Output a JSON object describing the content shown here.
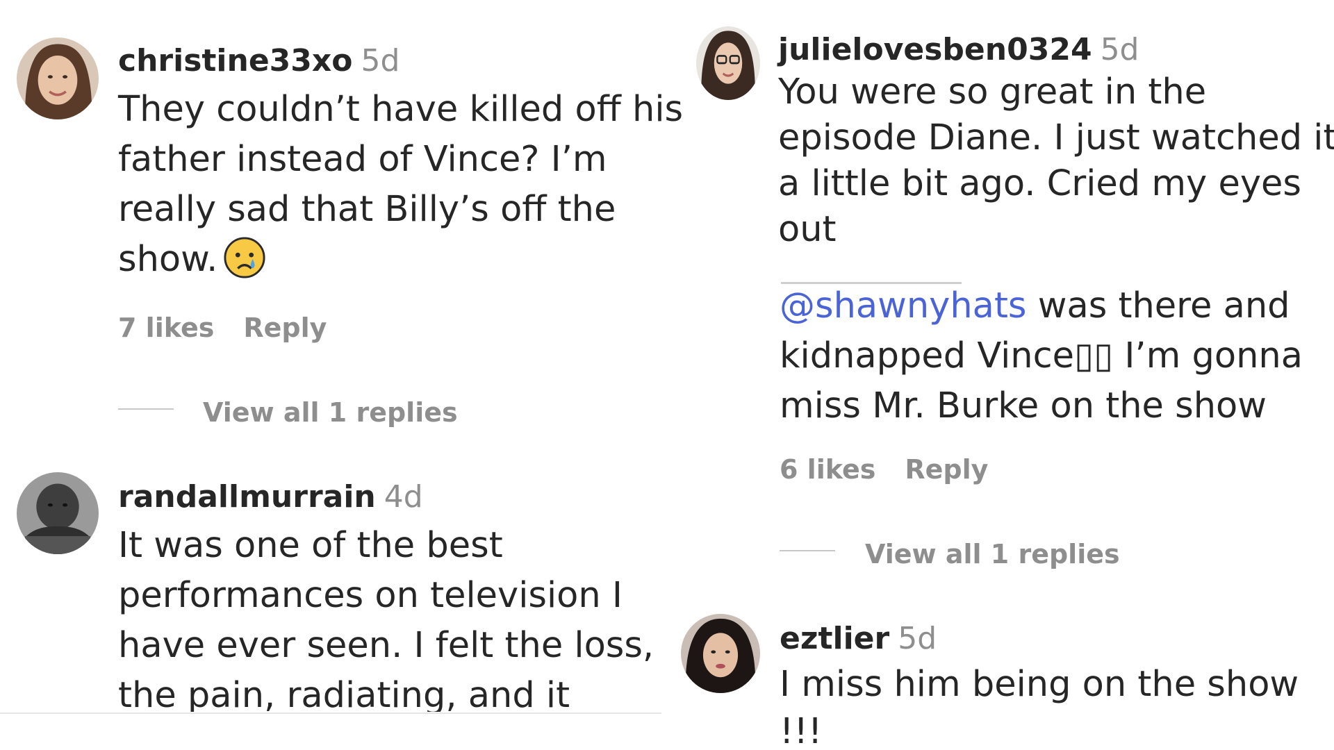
{
  "left_column": {
    "comments": [
      {
        "username": "christine33xo",
        "time": "5d",
        "lines": [
          "They couldn’t have killed off his",
          "father instead of Vince? I’m",
          "really sad that Billy’s off the",
          "show."
        ],
        "emoji": "crying-face-emoji",
        "likes": "7 likes",
        "reply": "Reply",
        "view_replies": "View all 1 replies"
      },
      {
        "username": "randallmurrain",
        "time": "4d",
        "lines": [
          "It was one of the best",
          "performances on television I",
          "have ever seen. I felt the loss,",
          "the pain, radiating, and it"
        ]
      }
    ]
  },
  "right_column": {
    "comments": [
      {
        "username": "julielovesben0324",
        "time": "5d",
        "lines": [
          "You were so great in the",
          "episode Diane. I just watched it",
          "a little bit ago. Cried my eyes",
          "out"
        ]
      },
      {
        "mention": "@shawnyhats",
        "lines": [
          " was there and",
          "kidnapped Vince▯▯ I’m gonna",
          "miss Mr. Burke on the show"
        ],
        "likes": "6 likes",
        "reply": "Reply",
        "view_replies": "View all 1 replies"
      },
      {
        "username": "eztlier",
        "time": "5d",
        "lines": [
          "I miss him being on the show",
          "!!!"
        ]
      }
    ]
  }
}
